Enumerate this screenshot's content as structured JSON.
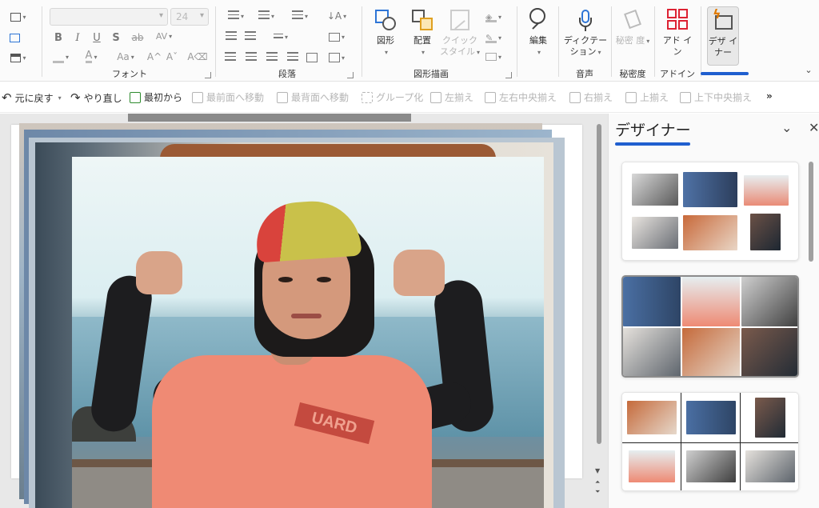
{
  "ribbon": {
    "font_size": "24",
    "groups": {
      "font": "フォント",
      "paragraph": "段落",
      "drawing": "図形描画",
      "voice": "音声",
      "sensitivity": "秘密度",
      "addins": "アドイン"
    },
    "buttons": {
      "shapes": "図形",
      "arrange": "配置",
      "quick_styles": "クイック スタイル",
      "editing": "編集",
      "dictate": "ディクテー ション",
      "sensitivity": "秘密 度",
      "addins": "アド イン",
      "designer": "デザ イナー"
    }
  },
  "toolbar": {
    "undo": "元に戻す",
    "redo": "やり直し",
    "from_beginning": "最初から",
    "bring_forward": "最前面へ移動",
    "send_backward": "最背面へ移動",
    "group": "グループ化",
    "align_left": "左揃え",
    "align_center": "左右中央揃え",
    "align_right": "右揃え",
    "align_top": "上揃え",
    "align_middle": "上下中央揃え",
    "more": "»"
  },
  "slide": {
    "shirt_text": "UARD"
  },
  "designer_pane": {
    "title": "デザイナー",
    "collapse_icon": "chevron-down-icon",
    "close_icon": "close-icon"
  },
  "colors": {
    "accent": "#1f5fcf",
    "designer_icon": "#e07a00",
    "shapes_blue": "#2e75d6"
  }
}
